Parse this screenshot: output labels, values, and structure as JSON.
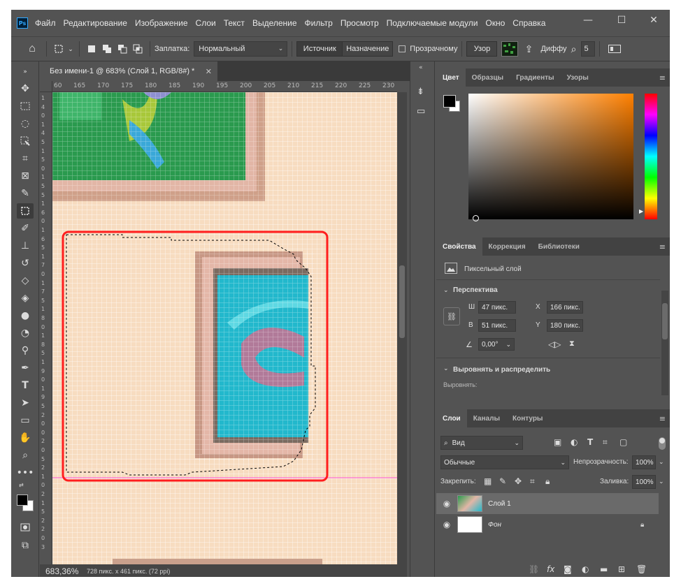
{
  "app": {
    "logo": "Ps",
    "menu": [
      "Файл",
      "Редактирование",
      "Изображение",
      "Слои",
      "Текст",
      "Выделение",
      "Фильтр",
      "Просмотр",
      "Подключаемые модули",
      "Окно",
      "Справка"
    ],
    "window_controls": {
      "minimize": "—",
      "maximize": "☐",
      "close": "✕"
    }
  },
  "options": {
    "fill_label": "Заплатка:",
    "fill_value": "Нормальный",
    "source_label": "Источник",
    "destination_label": "Назначение",
    "transparent_label": "Прозрачному",
    "pattern_label": "Узор",
    "diffuse_label": "Диффу",
    "diffuse_value": "5"
  },
  "document": {
    "tab_title": "Без имени-1 @ 683% (Слой 1, RGB/8#) *",
    "zoom": "683,36%",
    "info": "728 пикс. x 461 пикс. (72 ppi)",
    "ruler_h": [
      "60",
      "165",
      "170",
      "175",
      "180",
      "185",
      "190",
      "195",
      "200",
      "205",
      "210",
      "215",
      "220",
      "225",
      "230"
    ],
    "ruler_v": [
      "1",
      "4",
      "0",
      "1",
      "4",
      "5",
      "1",
      "5",
      "0",
      "1",
      "5",
      "5",
      "1",
      "6",
      "0",
      "1",
      "6",
      "5",
      "1",
      "7",
      "0",
      "1",
      "7",
      "5",
      "1",
      "8",
      "0",
      "1",
      "8",
      "5",
      "1",
      "9",
      "0",
      "1",
      "9",
      "5",
      "2",
      "0",
      "0",
      "2",
      "0",
      "5",
      "2",
      "1",
      "0",
      "2",
      "1",
      "5",
      "2",
      "2",
      "0",
      "3"
    ]
  },
  "color_panel": {
    "tabs": [
      "Цвет",
      "Образцы",
      "Градиенты",
      "Узоры"
    ],
    "foreground": "#000000",
    "background": "#ffffff",
    "hue_color": "#ff8000"
  },
  "properties_panel": {
    "tabs": [
      "Свойства",
      "Коррекция",
      "Библиотеки"
    ],
    "layer_type": "Пиксельный слой",
    "section_transform": "Перспектива",
    "w_label": "Ш",
    "w_value": "47 пикс.",
    "h_label": "В",
    "h_value": "51 пикс.",
    "x_label": "X",
    "x_value": "166 пикс.",
    "y_label": "Y",
    "y_value": "180 пикс.",
    "angle_value": "0,00°",
    "section_align": "Выровнять и распределить",
    "align_label": "Выровнять:"
  },
  "layers_panel": {
    "tabs": [
      "Слои",
      "Каналы",
      "Контуры"
    ],
    "filter_value": "Вид",
    "blend_mode": "Обычные",
    "opacity_label": "Непрозрачность:",
    "opacity_value": "100%",
    "lock_label": "Закрепить:",
    "fill_label": "Заливка:",
    "fill_value": "100%",
    "layers": [
      {
        "name": "Слой 1",
        "selected": true
      },
      {
        "name": "Фон",
        "selected": false,
        "locked": true
      }
    ]
  }
}
